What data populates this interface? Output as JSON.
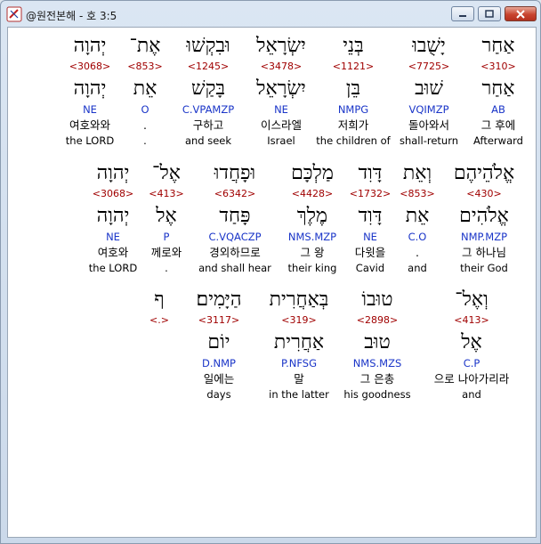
{
  "window": {
    "title": "@원전본해 - 호 3:5",
    "minimize_icon": "minimize-icon",
    "maximize_icon": "maximize-icon",
    "close_icon": "close-icon"
  },
  "rows": [
    {
      "words": [
        {
          "heb": "אַחַר",
          "strong": "<310>",
          "lemma": "אַחַר",
          "morph": "AB",
          "kor": "그 후에",
          "eng": "Afterward",
          "highlight": true
        },
        {
          "heb": "יָשֻׁבוּ",
          "strong": "<7725>",
          "lemma": "שׁוּב",
          "morph": "VQIMZP",
          "kor": "돌아와서",
          "eng": "shall-return"
        },
        {
          "heb": "בְּנֵי",
          "strong": "<1121>",
          "lemma": "בֵּן",
          "morph": "NMPG",
          "kor": "저희가",
          "eng": "the children of"
        },
        {
          "heb": "יִשְׂרָאֵל",
          "strong": "<3478>",
          "lemma": "יִשְׂרָאֵל",
          "morph": "NE",
          "kor": "이스라엘",
          "eng": "Israel"
        },
        {
          "heb": "וּבִקְשׁוּ",
          "strong": "<1245>",
          "lemma": "בָּקַשׁ",
          "morph": "C.VPAMZP",
          "kor": "구하고",
          "eng": "and seek"
        },
        {
          "heb": "אֶת־",
          "strong": "<853>",
          "lemma": "אֵת",
          "morph": "O",
          "kor": ".",
          "eng": "."
        },
        {
          "heb": "יְהוָה",
          "strong": "<3068>",
          "lemma": "יְהוָה",
          "morph": "NE",
          "kor": "여호와와",
          "eng": "the LORD"
        }
      ]
    },
    {
      "words": [
        {
          "heb": "אֱלֹהֵיהֶם",
          "strong": "<430>",
          "lemma": "אֱלֹהִים",
          "morph": "NMP.MZP",
          "kor": "그 하나님",
          "eng": "their God"
        },
        {
          "heb": "וְאֵת",
          "strong": "<853>",
          "lemma": "אֵת",
          "morph": "C.O",
          "kor": ".",
          "eng": "and"
        },
        {
          "heb": "דָּוִד",
          "strong": "<1732>",
          "lemma": "דָּוִד",
          "morph": "NE",
          "kor": "다윗을",
          "eng": "Cavid"
        },
        {
          "heb": "מַלְכָּם",
          "strong": "<4428>",
          "lemma": "מֶלֶךְ",
          "morph": "NMS.MZP",
          "kor": "그 왕",
          "eng": "their king"
        },
        {
          "heb": "וּפָחֲדוּ",
          "strong": "<6342>",
          "lemma": "פָּחַד",
          "morph": "C.VQACZP",
          "kor": "경외하므로",
          "eng": "and shall hear"
        },
        {
          "heb": "אֶל־",
          "strong": "<413>",
          "lemma": "אֶל",
          "morph": "P",
          "kor": "께로와",
          "eng": "."
        },
        {
          "heb": "יְהוָה",
          "strong": "<3068>",
          "lemma": "יְהוָה",
          "morph": "NE",
          "kor": "여호와",
          "eng": "the LORD"
        }
      ]
    },
    {
      "words": [
        {
          "heb": "וְאֶל־",
          "strong": "<413>",
          "lemma": "אֶל",
          "morph": "C.P",
          "kor": "으로 나아가리라",
          "eng": "and"
        },
        {
          "heb": "טוּבוֹ",
          "strong": "<2898>",
          "lemma": "טוּב",
          "morph": "NMS.MZS",
          "kor": "그 은총",
          "eng": "his goodness"
        },
        {
          "heb": "בְּאַחֲרִית",
          "strong": "<319>",
          "lemma": "אַחֲרִית",
          "morph": "P.NFSG",
          "kor": "말",
          "eng": "in the latter"
        },
        {
          "heb": "הַיָּמִים׃",
          "strong": "<3117>",
          "lemma": "יוֹם",
          "morph": "D.NMP",
          "kor": "일에는",
          "eng": "days"
        },
        {
          "heb": "ף",
          "strong": "<.>",
          "lemma": "",
          "morph": "",
          "kor": "",
          "eng": ""
        }
      ]
    }
  ]
}
